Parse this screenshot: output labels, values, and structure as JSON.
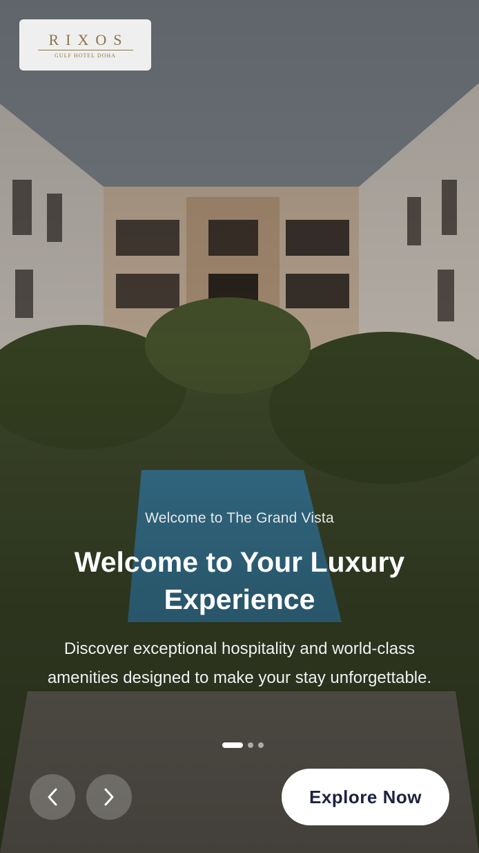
{
  "logo": {
    "brand": "RIXOS",
    "subtitle": "GULF HOTEL DOHA"
  },
  "hero": {
    "eyebrow": "Welcome to The Grand Vista",
    "headline": "Welcome to Your Luxury Experience",
    "description": "Discover exceptional hospitality and world-class amenities designed to make your stay unforgettable."
  },
  "carousel": {
    "slide_count": 3,
    "active_index": 0
  },
  "controls": {
    "prev_icon": "chevron-left-icon",
    "next_icon": "chevron-right-icon",
    "cta_label": "Explore Now"
  },
  "colors": {
    "cta_text": "#1c2340",
    "logo_gold": "#8a7548"
  }
}
